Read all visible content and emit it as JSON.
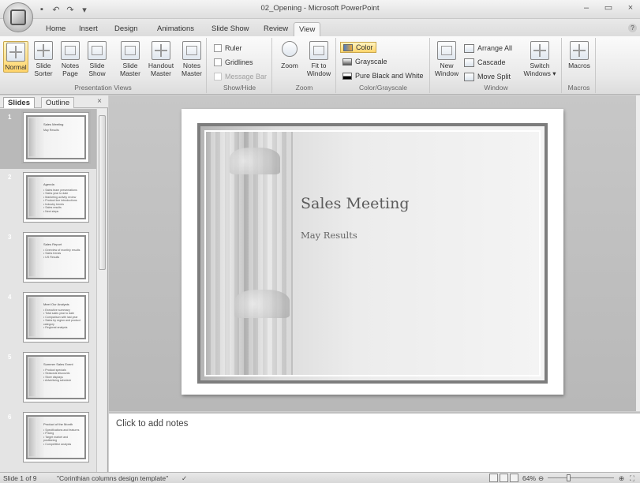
{
  "window": {
    "title": "02_Opening - Microsoft PowerPoint",
    "controls": [
      "–",
      "▭",
      "×"
    ]
  },
  "quick_access": [
    "save",
    "undo",
    "redo",
    "customize"
  ],
  "tabs": [
    "Home",
    "Insert",
    "Design",
    "Animations",
    "Slide Show",
    "Review",
    "View"
  ],
  "active_tab": "View",
  "ribbon": {
    "presentation_views": {
      "label": "Presentation Views",
      "buttons": [
        {
          "line1": "Normal",
          "line2": ""
        },
        {
          "line1": "Slide",
          "line2": "Sorter"
        },
        {
          "line1": "Notes",
          "line2": "Page"
        },
        {
          "line1": "Slide",
          "line2": "Show"
        },
        {
          "line1": "Slide",
          "line2": "Master"
        },
        {
          "line1": "Handout",
          "line2": "Master"
        },
        {
          "line1": "Notes",
          "line2": "Master"
        }
      ]
    },
    "show_hide": {
      "label": "Show/Hide",
      "ruler": "Ruler",
      "gridlines": "Gridlines",
      "message_bar": "Message Bar"
    },
    "zoom": {
      "label": "Zoom",
      "zoom": "Zoom",
      "fit_line1": "Fit to",
      "fit_line2": "Window"
    },
    "color_grayscale": {
      "label": "Color/Grayscale",
      "color": "Color",
      "grayscale": "Grayscale",
      "pure_bw": "Pure Black and White"
    },
    "window": {
      "label": "Window",
      "new_line1": "New",
      "new_line2": "Window",
      "arrange_all": "Arrange All",
      "cascade": "Cascade",
      "move_split": "Move Split",
      "switch_line1": "Switch",
      "switch_line2": "Windows ▾"
    },
    "macros": {
      "label": "Macros",
      "macros": "Macros"
    }
  },
  "panel": {
    "tab_slides": "Slides",
    "tab_outline": "Outline",
    "close": "×"
  },
  "thumbnails": [
    {
      "num": "1",
      "title": "Sales Meeting",
      "lines": [
        "May Results"
      ]
    },
    {
      "num": "2",
      "title": "Agenda",
      "lines": [
        "• Sales team presentations",
        "• Sales year to date",
        "• Marketing activity review",
        "• Product line introductions",
        "• Industry trends",
        "• Sales results",
        "• Next steps"
      ]
    },
    {
      "num": "3",
      "title": "Sales Report",
      "lines": [
        "• Overview of monthly results",
        "• Sales trends",
        "   • US Results"
      ]
    },
    {
      "num": "4",
      "title": "Meet Our Analysts",
      "lines": [
        "• Executive summary",
        "   • Total sales year to date",
        "   • Comparison with last year",
        "• Sales by region and product",
        "   category",
        "   • Regional analysis"
      ]
    },
    {
      "num": "5",
      "title": "Summer Sales Event",
      "lines": [
        "• Product specials",
        "• Seasonal discounts",
        "• Store displays",
        "• Advertising schedule"
      ]
    },
    {
      "num": "6",
      "title": "Product of the Month",
      "lines": [
        "• Specifications and features",
        "   • Pricing",
        "   • Target market and",
        "     positioning",
        "   • Competitive analysis"
      ]
    }
  ],
  "slide": {
    "title": "Sales Meeting",
    "subtitle": "May Results"
  },
  "notes": {
    "placeholder": "Click to add notes"
  },
  "status": {
    "slide_info": "Slide 1 of 9",
    "theme": "\"Corinthian columns design template\"",
    "zoom": "64%",
    "zoom_out": "⊖",
    "zoom_in": "⊕"
  }
}
